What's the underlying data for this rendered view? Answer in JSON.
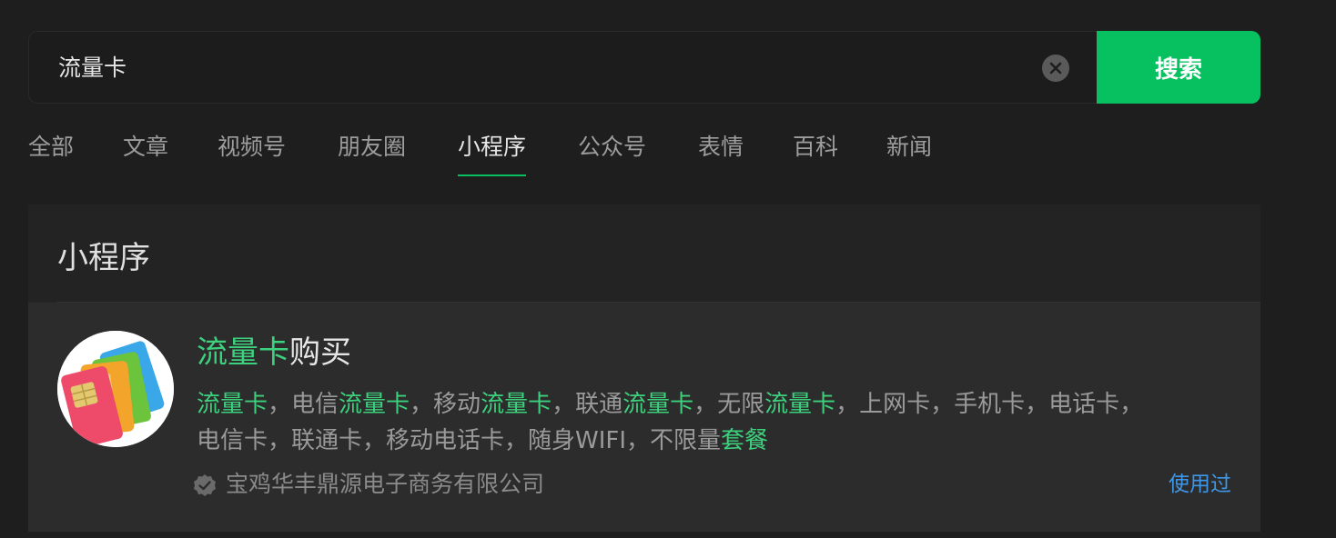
{
  "search": {
    "query": "流量卡",
    "button_label": "搜索"
  },
  "tabs": [
    {
      "label": "全部",
      "active": false
    },
    {
      "label": "文章",
      "active": false
    },
    {
      "label": "视频号",
      "active": false
    },
    {
      "label": "朋友圈",
      "active": false
    },
    {
      "label": "小程序",
      "active": true
    },
    {
      "label": "公众号",
      "active": false
    },
    {
      "label": "表情",
      "active": false
    },
    {
      "label": "百科",
      "active": false
    },
    {
      "label": "新闻",
      "active": false
    }
  ],
  "section": {
    "title": "小程序"
  },
  "result": {
    "title_highlight": "流量卡",
    "title_rest": "购买",
    "desc_line1": [
      {
        "text": "流量卡",
        "hl": true
      },
      {
        "text": "，电信",
        "hl": false
      },
      {
        "text": "流量卡",
        "hl": true
      },
      {
        "text": "，移动",
        "hl": false
      },
      {
        "text": "流量卡",
        "hl": true
      },
      {
        "text": "，联通",
        "hl": false
      },
      {
        "text": "流量卡",
        "hl": true
      },
      {
        "text": "，无限",
        "hl": false
      },
      {
        "text": "流量卡",
        "hl": true
      },
      {
        "text": "，上网卡，手机卡，电话卡，",
        "hl": false
      }
    ],
    "desc_line2": [
      {
        "text": "电信卡，联通卡，移动电话卡，随身WIFI，不限量",
        "hl": false
      },
      {
        "text": "套餐",
        "hl": true
      }
    ],
    "company": "宝鸡华丰鼎源电子商务有限公司",
    "used_label": "使用过"
  },
  "colors": {
    "accent": "#07c160",
    "highlight": "#3dd17d",
    "link": "#3e96e8",
    "background": "#1e1e1e"
  },
  "icons": {
    "clear": "close-icon",
    "verified": "check-badge-icon",
    "app": "sim-cards-icon"
  }
}
